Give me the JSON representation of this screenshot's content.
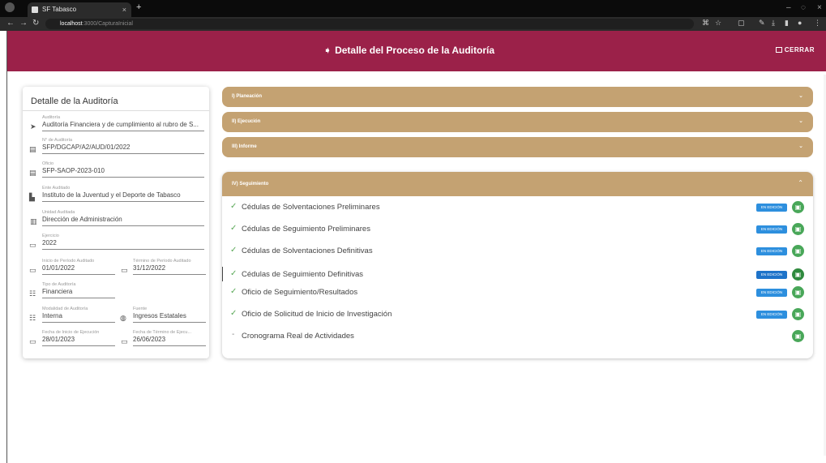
{
  "browser": {
    "tab_title": "SF Tabasco",
    "tab_close": "×",
    "new_tab": "+",
    "url_host": "localhost",
    "url_path": ":3000/CapturaInicial",
    "win_minimize": "–",
    "win_restore": "◌",
    "win_close": "×"
  },
  "header": {
    "title": "Detalle del Proceso de la Auditoría",
    "cerrar": "CERRAR"
  },
  "detail": {
    "title": "Detalle de la Auditoría",
    "fields": {
      "auditoria": {
        "label": "Auditoría",
        "value": "Auditoría Financiera y de cumplimiento al rubro de S..."
      },
      "numero": {
        "label": "N° de Auditoría",
        "value": "SFP/DGCAP/A2/AUD/01/2022"
      },
      "oficio": {
        "label": "Oficio",
        "value": "SFP-SAOP-2023-010"
      },
      "ente": {
        "label": "Ente Auditado",
        "value": "Instituto de la Juventud y el Deporte de Tabasco"
      },
      "unidad": {
        "label": "Unidad Auditada",
        "value": "Dirección de Administración"
      },
      "ejercicio": {
        "label": "Ejercicio",
        "value": "2022"
      },
      "inicio_periodo": {
        "label": "Inicio de Período Auditado",
        "value": "01/01/2022"
      },
      "termino_periodo": {
        "label": "Término de Período Auditado",
        "value": "31/12/2022"
      },
      "tipo": {
        "label": "Tipo de Auditoría",
        "value": "Financiera"
      },
      "modalidad": {
        "label": "Modalidad de Auditoría",
        "value": "Interna"
      },
      "fuente": {
        "label": "Fuente",
        "value": "Ingresos Estatales"
      },
      "inicio_ejecucion": {
        "label": "Fecha de Inicio de Ejecución",
        "value": "28/01/2023"
      },
      "termino_ejecucion": {
        "label": "Fecha de Término de Ejecu...",
        "value": "26/06/2023"
      }
    }
  },
  "sections": {
    "planeacion": "I) Planeación",
    "ejecucion": "II) Ejecución",
    "informe": "III) Informe",
    "seguimiento": "IV) Seguimiento"
  },
  "seguimiento_items": [
    {
      "label": "Cédulas de Solventaciones Preliminares",
      "badge": "EN EDICIÓN",
      "done": true
    },
    {
      "label": "Cédulas de Seguimiento Preliminares",
      "badge": "EN EDICIÓN",
      "done": true
    },
    {
      "label": "Cédulas de Solventaciones Definitivas",
      "badge": "EN EDICIÓN",
      "done": true
    },
    {
      "label": "Cédulas de Seguimiento Definitivas",
      "badge": "EN EDICIÓN",
      "done": true
    },
    {
      "label": "Oficio de Seguimiento/Resultados",
      "badge": "EN EDICIÓN",
      "done": true
    },
    {
      "label": "Oficio de Solicitud de Inicio de Investigación",
      "badge": "EN EDICIÓN",
      "done": true
    },
    {
      "label": "Cronograma Real de Actividades",
      "badge": "",
      "done": false
    }
  ],
  "colors": {
    "header": "#9b2149",
    "accordion": "#c4a272",
    "badge": "#2d8fde",
    "action": "#49a759"
  },
  "icons": {
    "check": "✓",
    "chevron_down": "⌄",
    "chevron_up": "⌃"
  }
}
